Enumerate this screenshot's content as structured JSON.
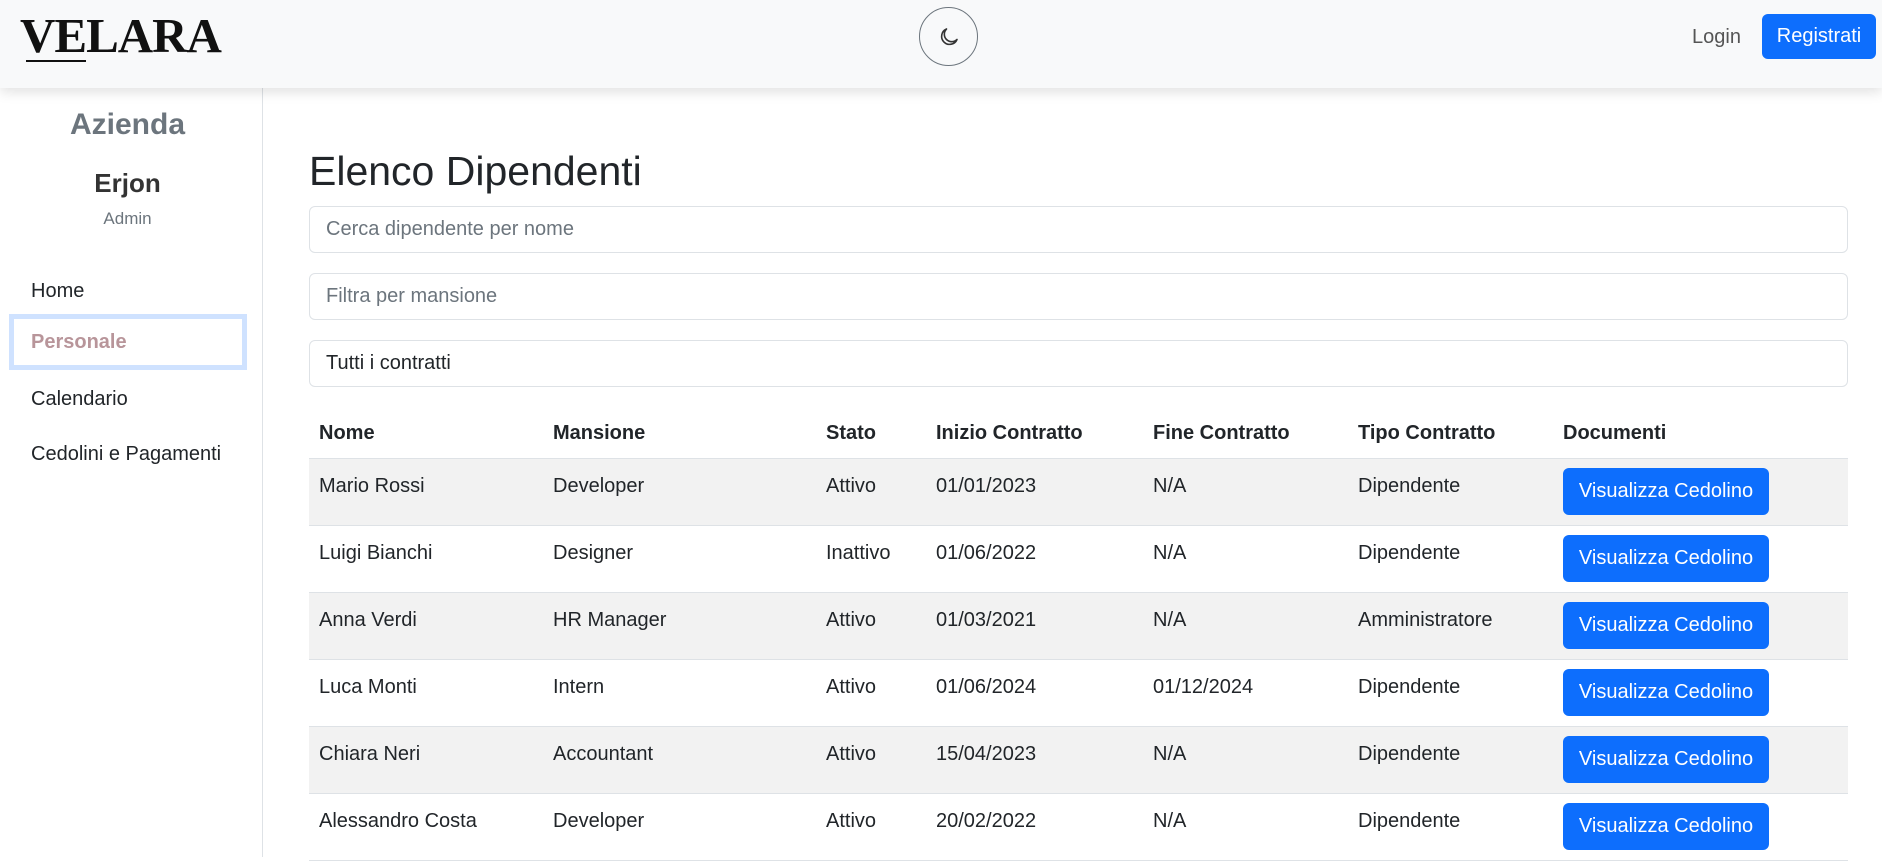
{
  "navbar": {
    "logo": "VELARA",
    "theme_icon": "moon-icon",
    "login": "Login",
    "register": "Registrati",
    "accent": "#0d6efd"
  },
  "sidebar": {
    "company": "Azienda",
    "user_name": "Erjon",
    "user_role": "Admin",
    "items": [
      {
        "label": "Home",
        "active": false
      },
      {
        "label": "Personale",
        "active": true
      },
      {
        "label": "Calendario",
        "active": false
      },
      {
        "label": "Cedolini e Pagamenti",
        "active": false
      }
    ]
  },
  "main": {
    "title": "Elenco Dipendenti",
    "search_placeholder": "Cerca dipendente per nome",
    "filter_placeholder": "Filtra per mansione",
    "contract_select": "Tutti i contratti",
    "table": {
      "headers": [
        "Nome",
        "Mansione",
        "Stato",
        "Inizio Contratto",
        "Fine Contratto",
        "Tipo Contratto",
        "Documenti"
      ],
      "button_label": "Visualizza Cedolino",
      "rows": [
        [
          "Mario Rossi",
          "Developer",
          "Attivo",
          "01/01/2023",
          "N/A",
          "Dipendente"
        ],
        [
          "Luigi Bianchi",
          "Designer",
          "Inattivo",
          "01/06/2022",
          "N/A",
          "Dipendente"
        ],
        [
          "Anna Verdi",
          "HR Manager",
          "Attivo",
          "01/03/2021",
          "N/A",
          "Amministratore"
        ],
        [
          "Luca Monti",
          "Intern",
          "Attivo",
          "01/06/2024",
          "01/12/2024",
          "Dipendente"
        ],
        [
          "Chiara Neri",
          "Accountant",
          "Attivo",
          "15/04/2023",
          "N/A",
          "Dipendente"
        ],
        [
          "Alessandro Costa",
          "Developer",
          "Attivo",
          "20/02/2022",
          "N/A",
          "Dipendente"
        ]
      ]
    }
  }
}
